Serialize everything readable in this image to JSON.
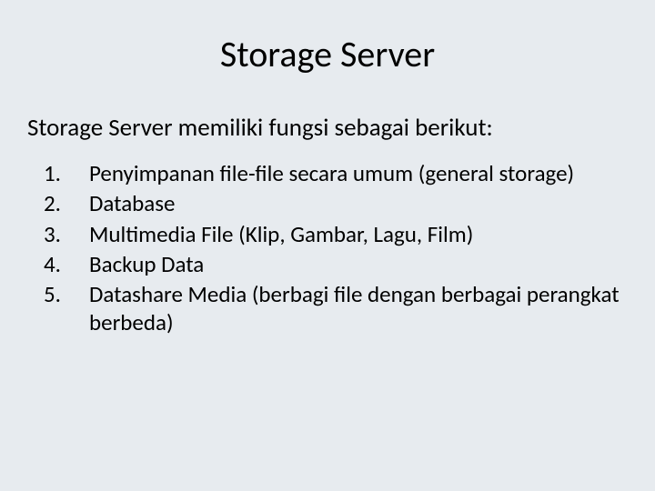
{
  "slide": {
    "title": "Storage Server",
    "intro": "Storage Server memiliki fungsi sebagai berikut:",
    "items": [
      "Penyimpanan file-file secara umum (general storage)",
      " Database",
      " Multimedia File (Klip, Gambar, Lagu, Film)",
      " Backup Data",
      " Datashare Media (berbagi file dengan berbagai perangkat berbeda)"
    ]
  }
}
